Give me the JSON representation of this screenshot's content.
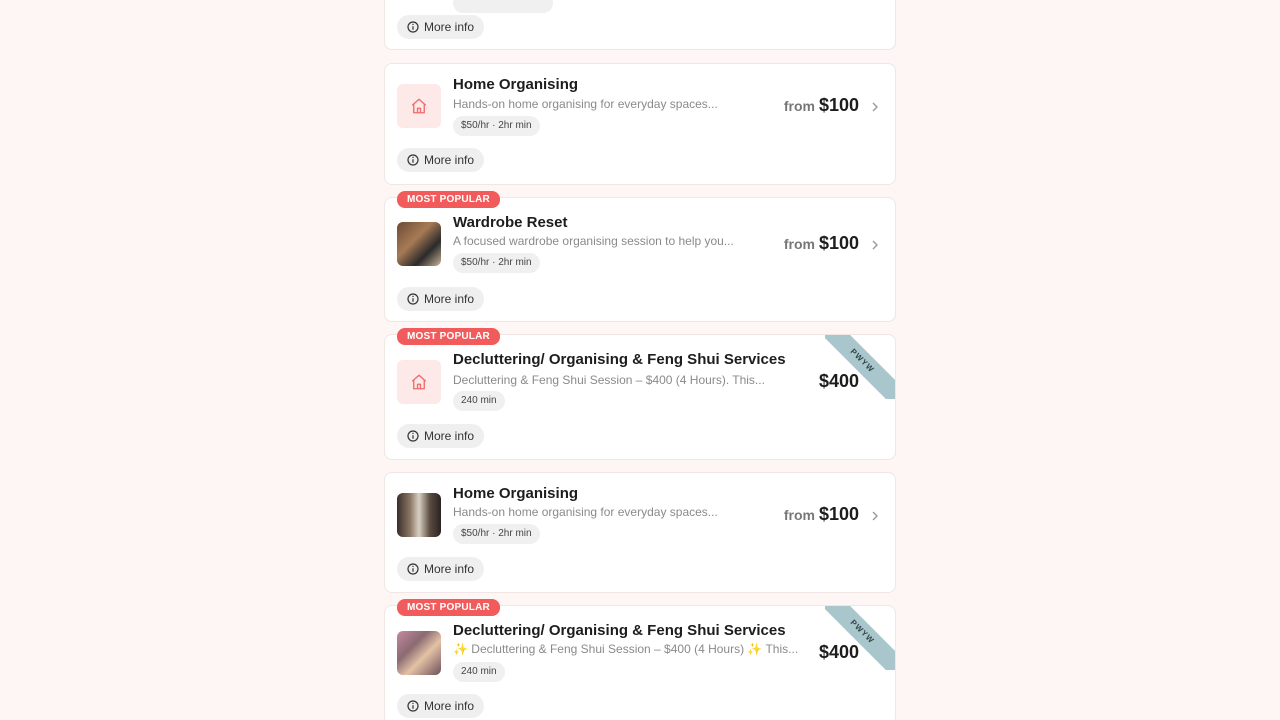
{
  "more_info_label": "More info",
  "cards": [
    {
      "more": "More info"
    },
    {
      "title": "Home Organising",
      "desc": "Hands-on home organising for everyday spaces...",
      "pill": "$50/hr · 2hr min",
      "from": "from",
      "price": "$100",
      "more": "More info"
    },
    {
      "badge": "MOST POPULAR",
      "title": "Wardrobe Reset",
      "desc": "A focused wardrobe organising session to help you...",
      "pill": "$50/hr · 2hr min",
      "from": "from",
      "price": "$100",
      "more": "More info"
    },
    {
      "badge": "MOST POPULAR",
      "title": "Decluttering/ Organising & Feng Shui Services",
      "desc": "Decluttering & Feng Shui Session – $400 (4 Hours). This...",
      "pill": "240 min",
      "price": "$400",
      "ribbon": "PWYW",
      "more": "More info"
    },
    {
      "title": "Home Organising",
      "desc": "Hands-on home organising for everyday spaces...",
      "pill": "$50/hr · 2hr min",
      "from": "from",
      "price": "$100",
      "more": "More info"
    },
    {
      "badge": "MOST POPULAR",
      "title": "Decluttering/ Organising & Feng Shui Services",
      "desc": "✨ Decluttering & Feng Shui Session – $400 (4 Hours) ✨ This...",
      "pill": "240 min",
      "price": "$400",
      "ribbon": "PWYW",
      "more": "More info"
    }
  ],
  "colors": {
    "accent": "#f15b5b",
    "ribbon": "#a9c6cc",
    "background": "#fdf6f5"
  },
  "icons": {
    "service_placeholder": "home-icon",
    "more": "info-icon",
    "chevron": "chevron-right-icon"
  }
}
